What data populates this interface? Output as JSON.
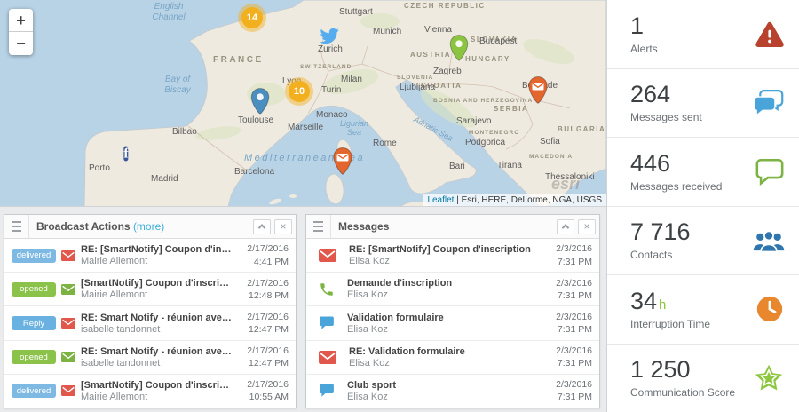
{
  "colors": {
    "alert_red": "#b8422e",
    "sent_blue": "#49a4d9",
    "received_green": "#7cb342",
    "contacts_blue": "#2e76ad",
    "time_orange": "#e8872e",
    "score_green": "#8dc63f",
    "badge_delivered": "#7db9e2",
    "badge_opened": "#8bc34a",
    "badge_reply": "#68b1e0",
    "mail_red": "#e2574c",
    "pin_orange": "#e2662d",
    "pin_blue": "#4a8fc0",
    "pin_green": "#8bc440",
    "cluster_yellow": "#f2b01f",
    "twitter_blue": "#55acee",
    "facebook_blue": "#3b5998"
  },
  "map": {
    "zoom_in_label": "+",
    "zoom_out_label": "−",
    "attribution": {
      "leaflet": "Leaflet",
      "rest": " | Esri, HERE, DeLorme, NGA, USGS"
    },
    "esri_watermark": "esri",
    "clusters": {
      "a": "14",
      "b": "10"
    },
    "facebook_label": "f",
    "marker_icons": [
      "cluster-14",
      "cluster-10",
      "twitter-icon",
      "facebook-icon",
      "pin-blue",
      "pin-green",
      "mail-pin-belgrade",
      "mail-pin-corsica"
    ],
    "countries": {
      "france": "FRANCE",
      "switzerland": "SWITZERLAND",
      "austria": "AUSTRIA",
      "hungary": "HUNGARY",
      "slovakia": "SLOVAKIA",
      "czech": "CZECH REPUBLIC",
      "slovenia": "SLOVENIA",
      "croatia": "CROATIA",
      "bosnia": "BOSNIA AND HERZEGOVINA",
      "serbia": "SERBIA",
      "montenegro": "MONTENEGRO",
      "macedonia": "MACEDONIA",
      "bulgaria": "BULGARIA"
    },
    "seas": {
      "english_channel": "English Channel",
      "bay_of_biscay": "Bay of Biscay",
      "mediterranean": "Mediterranean Sea",
      "ligurian": "Ligurian Sea",
      "adriatic": "Adriatic Sea"
    },
    "cities": {
      "porto": "Porto",
      "madrid": "Madrid",
      "bilbao": "Bilbao",
      "toulouse": "Toulouse",
      "barcelona": "Barcelona",
      "marseille": "Marseille",
      "monaco": "Monaco",
      "lyon": "Lyon",
      "turin": "Turin",
      "milan": "Milan",
      "zurich": "Zurich",
      "munich": "Munich",
      "stuttgart": "Stuttgart",
      "vienna": "Vienna",
      "budapest": "Budapest",
      "zagreb": "Zagreb",
      "ljubljana": "Ljubljana",
      "belgrade": "Belgrade",
      "sarajevo": "Sarajevo",
      "sofia": "Sofia",
      "podgorica": "Podgorica",
      "tirana": "Tirana",
      "rome": "Rome",
      "bari": "Bari",
      "thessaloniki": "Thessaloniki"
    }
  },
  "stats": [
    {
      "value": "1",
      "label": "Alerts",
      "icon": "alert-icon"
    },
    {
      "value": "264",
      "label": "Messages sent",
      "icon": "chat-bubbles-icon"
    },
    {
      "value": "446",
      "label": "Messages received",
      "icon": "chat-bubble-icon"
    },
    {
      "value": "7 716",
      "label": "Contacts",
      "icon": "people-icon"
    },
    {
      "value": "34",
      "unit": "h",
      "label": "Interruption Time",
      "icon": "clock-icon"
    },
    {
      "value": "1 250",
      "label": "Communication Score",
      "icon": "star-icon"
    }
  ],
  "broadcast": {
    "title": "Broadcast Actions",
    "more_label": "(more)",
    "rows": [
      {
        "badge": "delivered",
        "icon": "mail-icon",
        "title": "RE: [SmartNotify] Coupon d'inscription",
        "name": "Mairie Allemont",
        "date": "2/17/2016",
        "time": "4:41 PM"
      },
      {
        "badge": "opened",
        "icon": "mail-icon",
        "title": "[SmartNotify] Coupon d'inscription",
        "name": "Mairie Allemont",
        "date": "2/17/2016",
        "time": "12:48 PM"
      },
      {
        "badge": "Reply",
        "icon": "mail-icon",
        "title": "RE: Smart Notify - réunion avec Christian Eohs",
        "name": "isabelle tandonnet",
        "date": "2/17/2016",
        "time": "12:47 PM"
      },
      {
        "badge": "opened",
        "icon": "mail-icon",
        "title": "RE: Smart Notify - réunion avec Christian Eohs",
        "name": "isabelle tandonnet",
        "date": "2/17/2016",
        "time": "12:47 PM"
      },
      {
        "badge": "delivered",
        "icon": "mail-icon",
        "title": "[SmartNotify] Coupon d'inscription",
        "name": "Mairie Allemont",
        "date": "2/17/2016",
        "time": "10:55 AM"
      }
    ]
  },
  "messages": {
    "title": "Messages",
    "rows": [
      {
        "icon": "mail-icon",
        "title": "RE: [SmartNotify] Coupon d'inscription",
        "name": "Elisa Koz",
        "date": "2/3/2016",
        "time": "7:31 PM"
      },
      {
        "icon": "phone-icon",
        "title": "Demande d'inscription",
        "name": "Elisa Koz",
        "date": "2/3/2016",
        "time": "7:31 PM"
      },
      {
        "icon": "chat-icon",
        "title": "Validation formulaire",
        "name": "Elisa Koz",
        "date": "2/3/2016",
        "time": "7:31 PM"
      },
      {
        "icon": "mail-icon",
        "title": "RE: Validation formulaire",
        "name": "Elisa Koz",
        "date": "2/3/2016",
        "time": "7:31 PM"
      },
      {
        "icon": "chat-icon",
        "title": "Club sport",
        "name": "Elisa Koz",
        "date": "2/3/2016",
        "time": "7:31 PM"
      }
    ]
  }
}
